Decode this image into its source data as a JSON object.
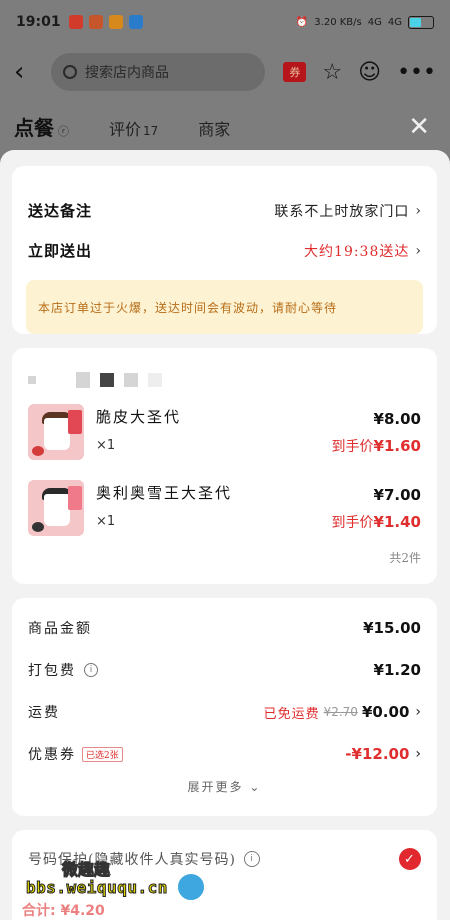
{
  "status_bar": {
    "time": "19:01",
    "network": "3.20 KB/s",
    "signal1": "4G",
    "signal2": "4G",
    "battery": "51"
  },
  "nav": {
    "search_placeholder": "搜索店内商品",
    "coupon_label": "券"
  },
  "tabs": {
    "order": "点餐",
    "reviews": "评价",
    "reviews_count": "17",
    "merchant": "商家"
  },
  "delivery": {
    "note_label": "送达备注",
    "note_value": "联系不上时放家门口",
    "time_label": "立即送出",
    "time_value": "大约19:38送达",
    "notice": "本店订单过于火爆，送达时间会有波动，请耐心等待"
  },
  "items": [
    {
      "name": "脆皮大圣代",
      "qty": "×1",
      "price": "¥8.00",
      "final_label": "到手价",
      "final_price": "¥1.60"
    },
    {
      "name": "奥利奥雪王大圣代",
      "qty": "×1",
      "price": "¥7.00",
      "final_label": "到手价",
      "final_price": "¥1.40"
    }
  ],
  "items_total_count": "共2件",
  "fees": {
    "goods_label": "商品金额",
    "goods_amount": "¥15.00",
    "packing_label": "打包费",
    "packing_amount": "¥1.20",
    "shipping_label": "运费",
    "shipping_free": "已免运费",
    "shipping_original": "¥2.70",
    "shipping_amount": "¥0.00",
    "coupon_label": "优惠券",
    "coupon_chosen": "已选2张",
    "coupon_amount": "-¥12.00",
    "expand": "展开更多"
  },
  "privacy": {
    "label": "号码保护(隐藏收件人真实号码)"
  },
  "footer": {
    "total_peek": "合计: ¥4.20"
  },
  "watermark": {
    "line1": "微趣趣",
    "line2": "bbs.weiququ.cn"
  },
  "colors": {
    "accent_red": "#e02d2d",
    "notice_bg": "#fdf3d3",
    "notice_text": "#b86d18"
  }
}
